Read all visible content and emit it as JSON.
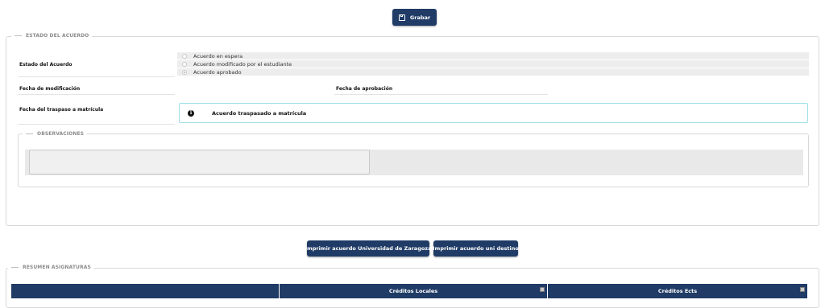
{
  "toolbar": {
    "save_label": "Grabar",
    "save_icon": "save-icon"
  },
  "estado_section": {
    "legend": "ESTADO DEL ACUERDO",
    "estado_label": "Estado del Acuerdo",
    "radio_options": [
      {
        "label": "Acuerdo en espera",
        "selected": false
      },
      {
        "label": "Acuerdo modificado por el estudiante",
        "selected": false
      },
      {
        "label": "Acuerdo aprobado",
        "selected": true
      }
    ],
    "fecha_modificacion_label": "Fecha de modificación",
    "fecha_aprobacion_label": "Fecha de aprobación",
    "fecha_traspaso_label": "Fecha del traspaso a matrícula",
    "info_icon": "i",
    "info_message": "Acuerdo traspasado a matrícula",
    "observaciones": {
      "legend": "OBSERVACIONES",
      "value": ""
    }
  },
  "actions": {
    "print_unizar_label": "Imprimir acuerdo Universidad de Zaragoza",
    "print_destino_label": "Imprimir acuerdo uni destino"
  },
  "resumen_section": {
    "legend": "RESUMEN ASIGNATURAS",
    "columns": [
      "",
      "Créditos Locales",
      "Créditos Ects"
    ]
  },
  "colors": {
    "primary": "#1f3b66",
    "info_border": "#9fe0e7",
    "legend": "#8c8c8c"
  }
}
